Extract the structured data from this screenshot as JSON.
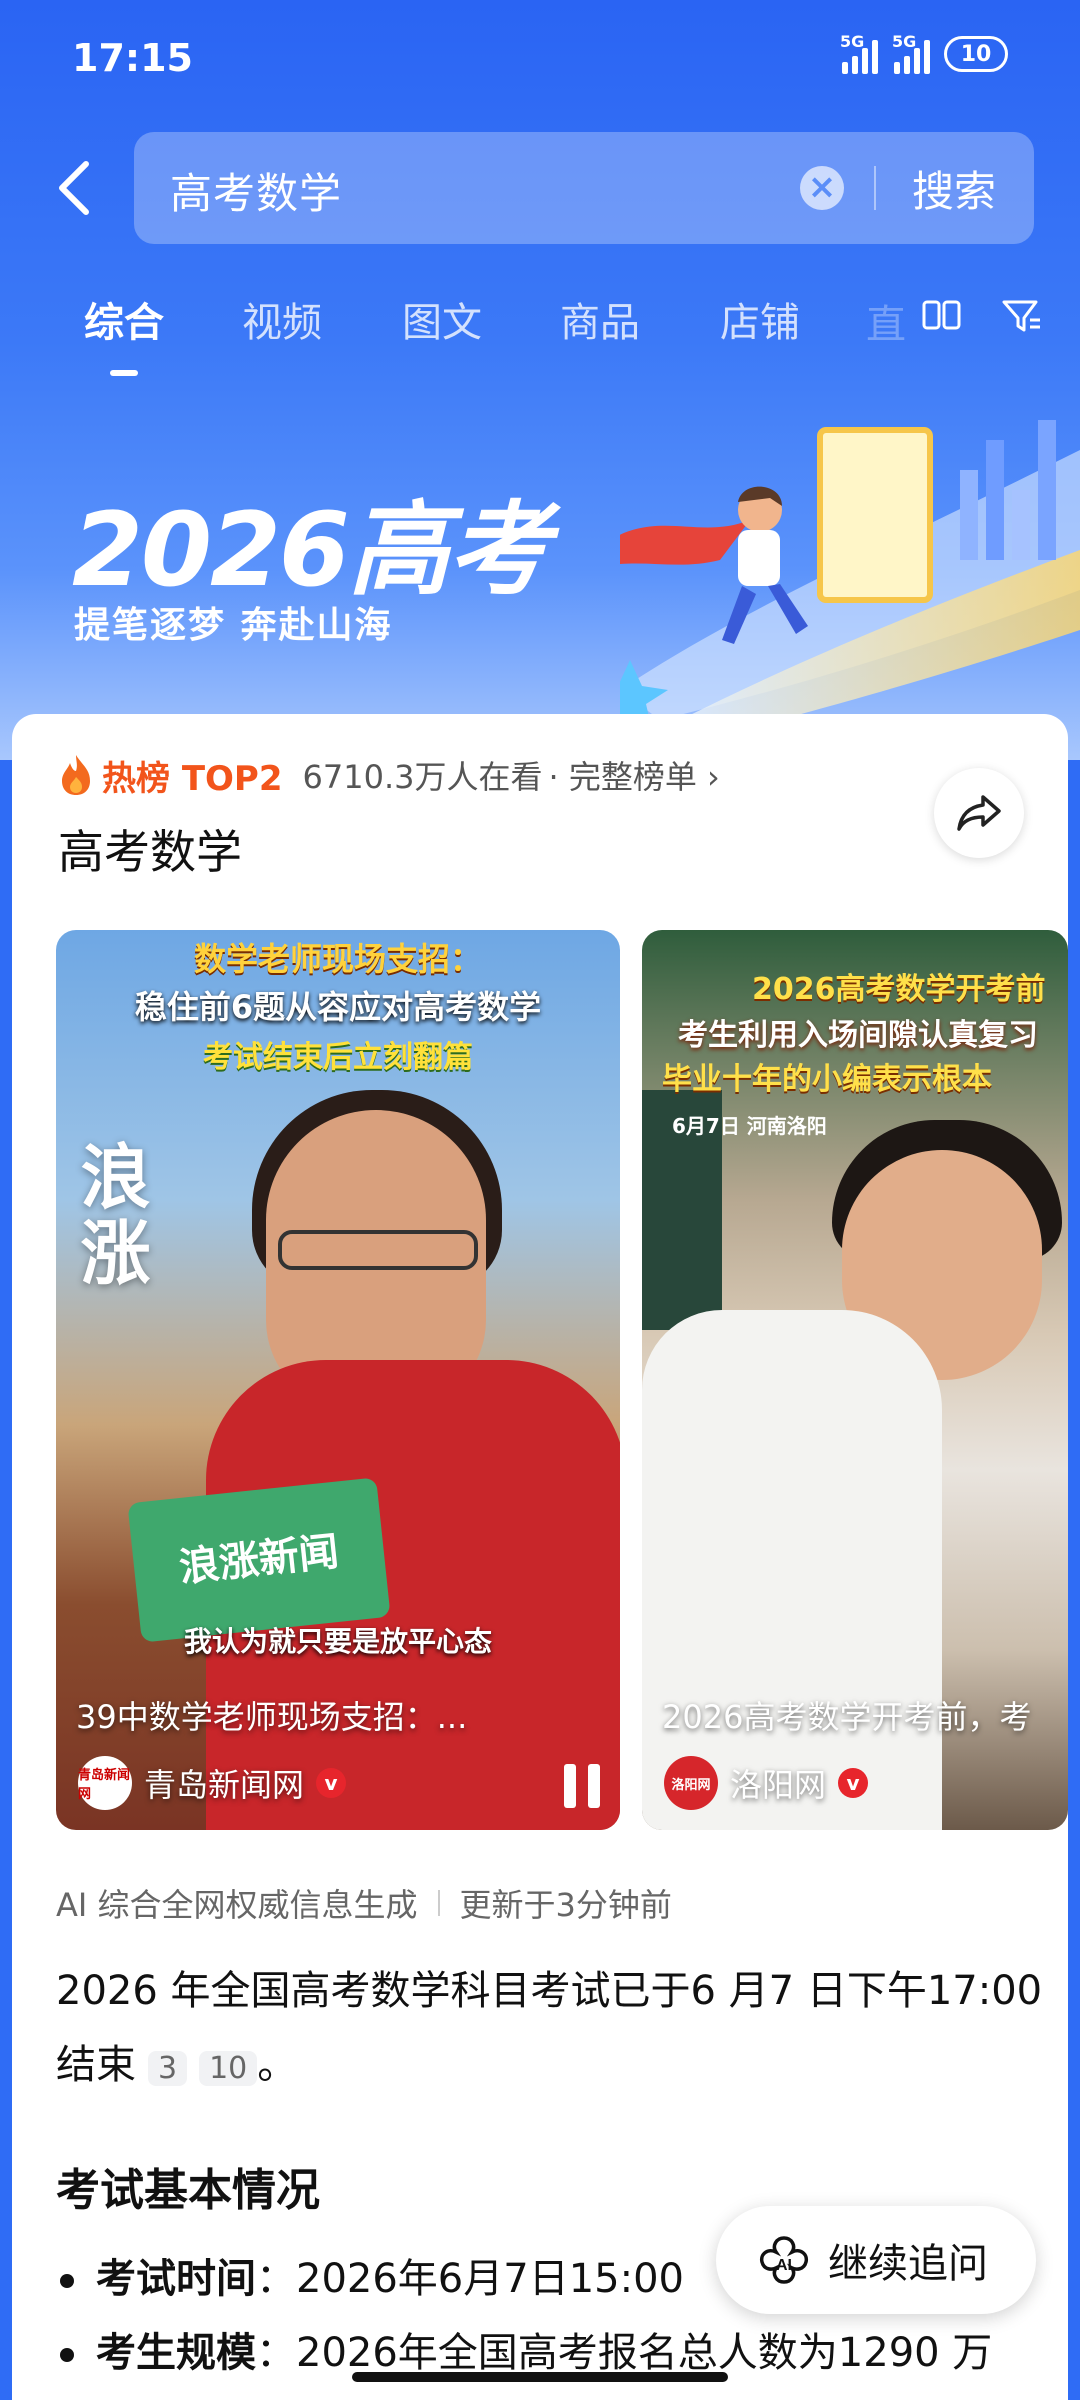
{
  "status": {
    "time": "17:15",
    "signal1": "5G",
    "signal2": "5G",
    "battery": "10"
  },
  "search": {
    "query": "高考数学",
    "submit_label": "搜索"
  },
  "tabs": [
    {
      "label": "综合",
      "active": true
    },
    {
      "label": "视频"
    },
    {
      "label": "图文"
    },
    {
      "label": "商品"
    },
    {
      "label": "店铺"
    },
    {
      "label": "直"
    }
  ],
  "banner": {
    "title": "2026高考",
    "subtitle": "提笔逐梦 奔赴山海"
  },
  "card": {
    "hot_label": "热榜 TOP2",
    "viewers": "6710.3万人在看",
    "full_list": "· 完整榜单 ›",
    "title": "高考数学"
  },
  "videos": [
    {
      "overlay1": "数学老师现场支招：",
      "overlay2": "稳住前6题从容应对高考数学",
      "overlay3": "考试结束后立刻翻篇",
      "brush": "浪涨",
      "mic_text": "浪涨新闻",
      "subtitle": "我认为就只要是放平心态",
      "caption": "39中数学老师现场支招：...",
      "source": "青岛新闻网",
      "logo": "青岛新闻网"
    },
    {
      "overlay1": "2026高考数学开考前",
      "overlay2": "考生利用入场间隙认真复习",
      "overlay3": "毕业十年的小编表示根本",
      "overlay4": "6月7日 河南洛阳",
      "caption": "2026高考数学开考前，考",
      "source": "洛阳网",
      "logo": "洛阳网"
    }
  ],
  "ai": {
    "meta_left": "AI 综合全网权威信息生成",
    "meta_right": "更新于3分钟前",
    "paragraph": "2026 年全国高考数学科目考试已于6 月7 日下午17:00结束",
    "ref1": "3",
    "ref2": "10",
    "period": "。",
    "section_title": "考试基本情况",
    "bullets": [
      {
        "label": "考试时间",
        "text": "：2026年6月7日15:00"
      },
      {
        "label": "考生规模",
        "text": "：2026年全国高考报名总人数为1290 万"
      }
    ]
  },
  "followup": {
    "label": "继续追问"
  }
}
